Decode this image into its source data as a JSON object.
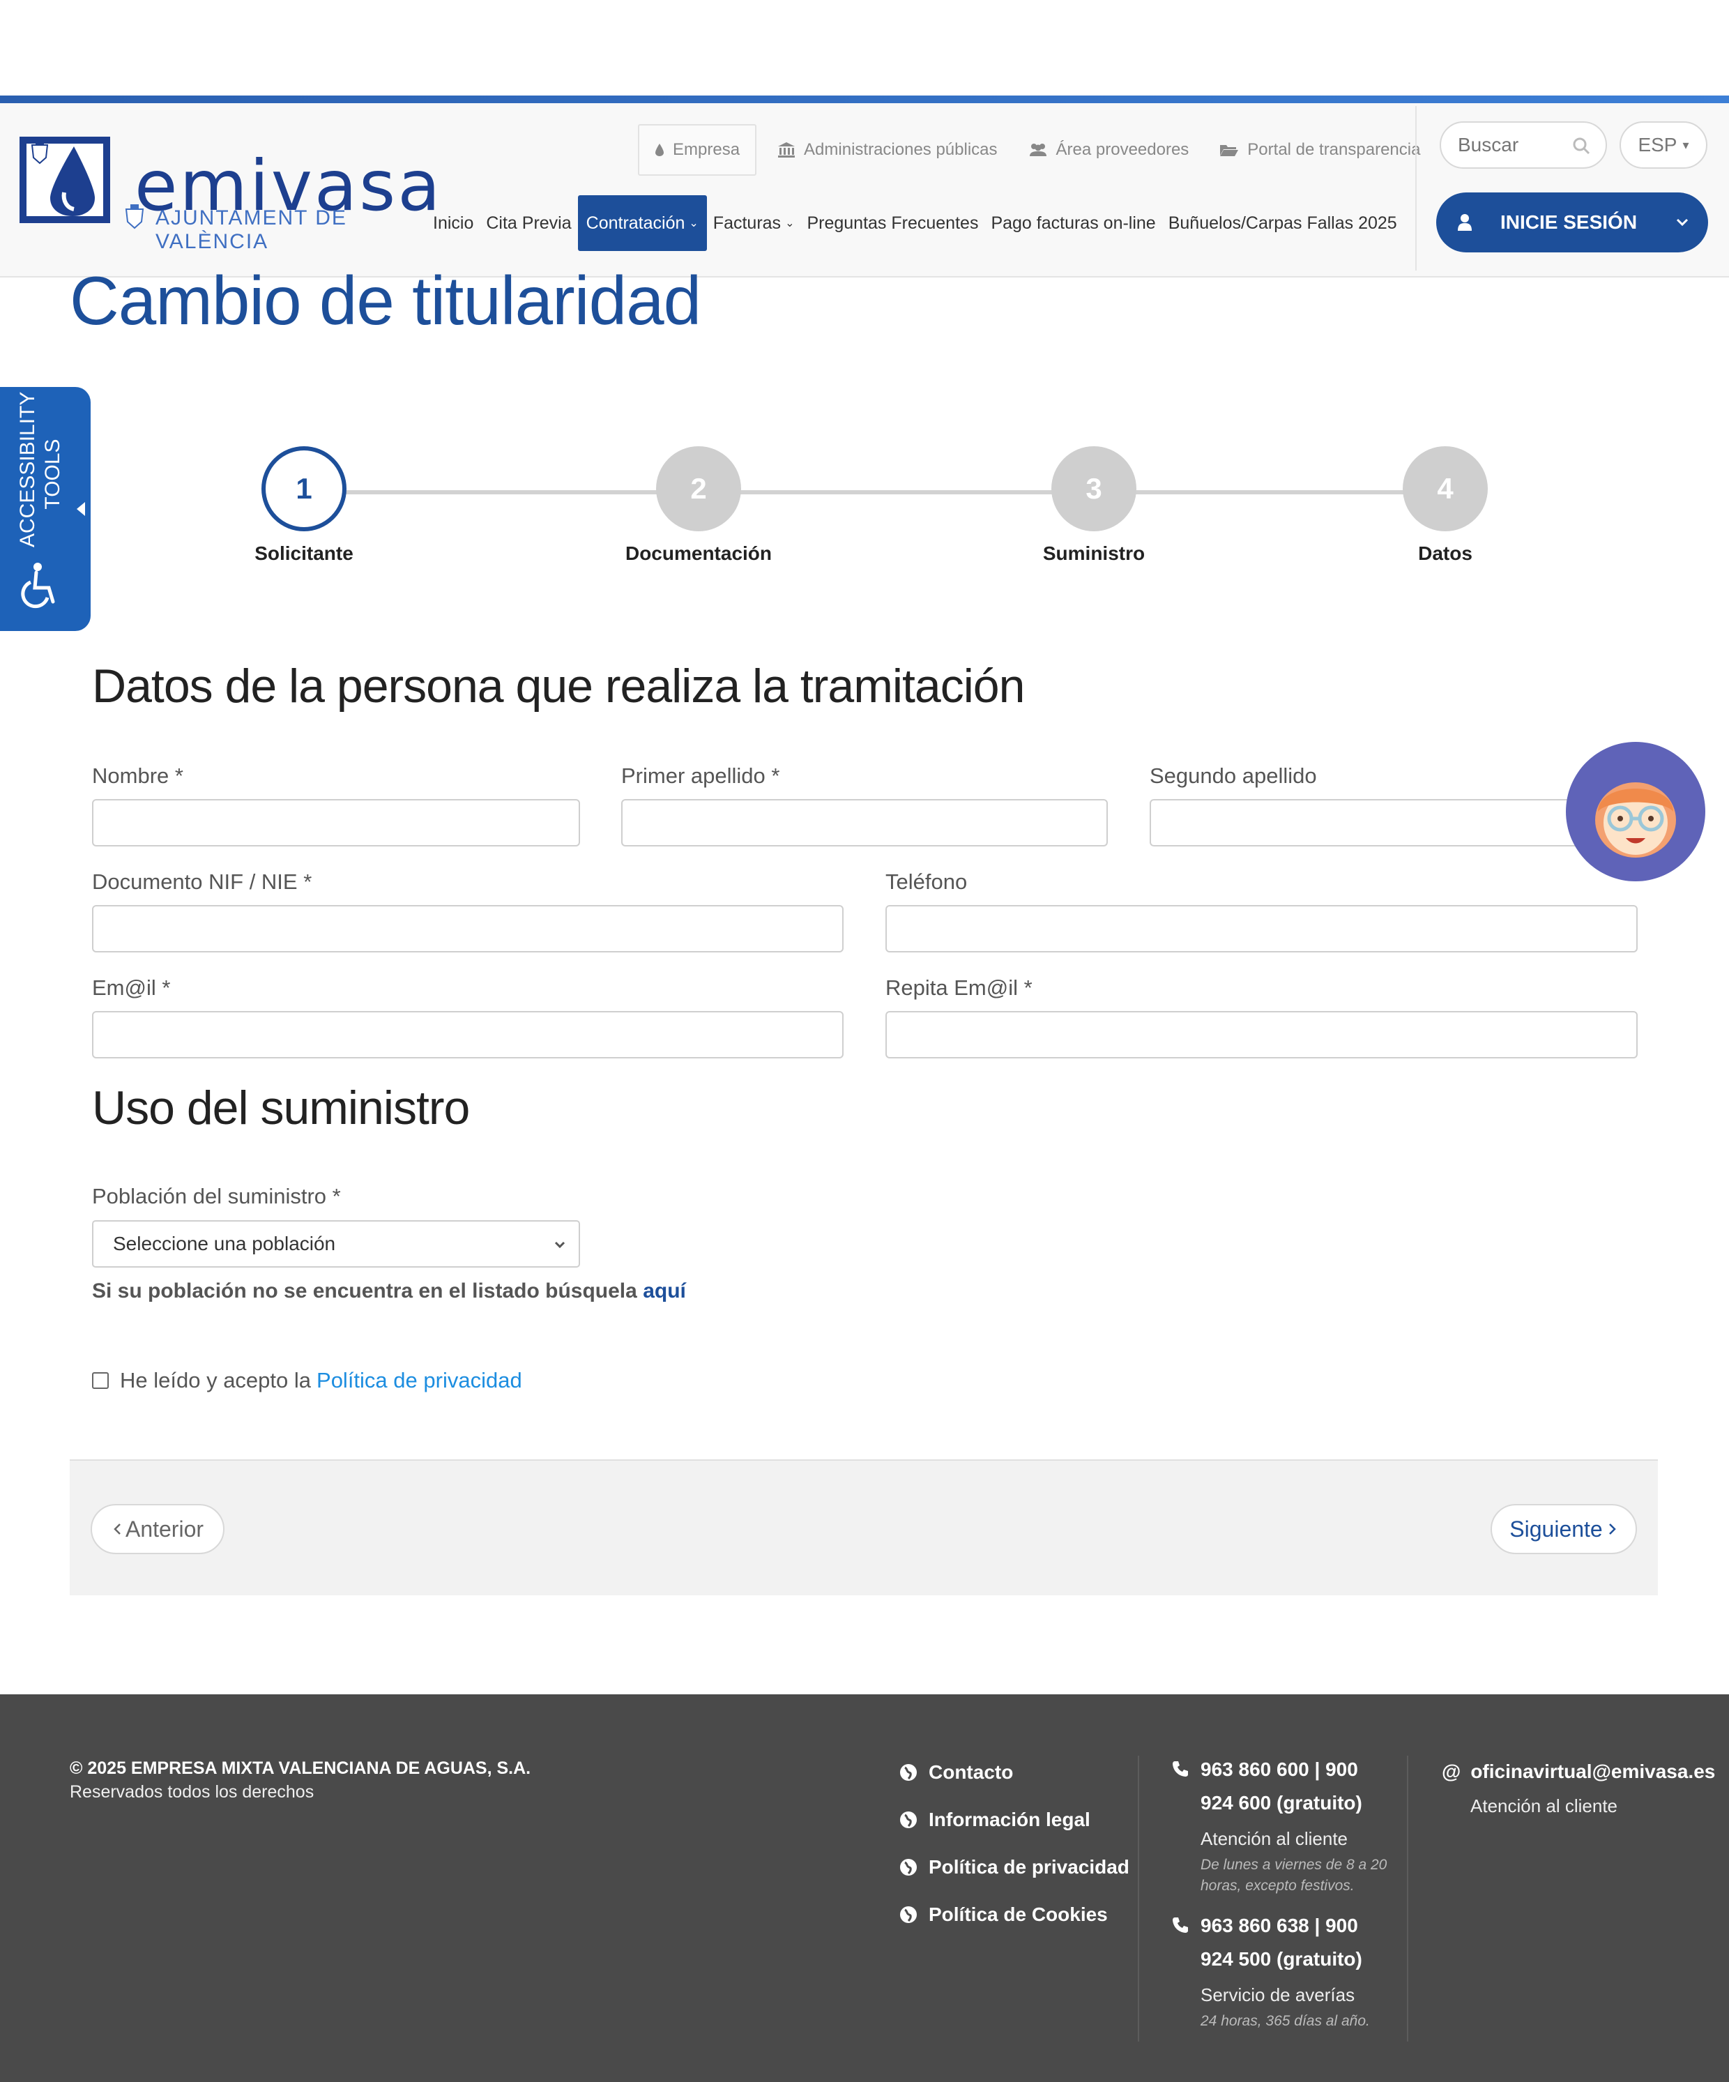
{
  "header": {
    "logo": {
      "word": "emivasa",
      "subtitle": "AJUNTAMENT DE VALÈNCIA"
    },
    "top_nav": [
      {
        "label": "Empresa",
        "icon": "drop-icon"
      },
      {
        "label": "Administraciones públicas",
        "icon": "institution-icon"
      },
      {
        "label": "Área proveedores",
        "icon": "users-icon"
      },
      {
        "label": "Portal de transparencia",
        "icon": "folder-open-icon"
      }
    ],
    "main_nav": [
      {
        "label": "Inicio"
      },
      {
        "label": "Cita Previa"
      },
      {
        "label": "Contratación",
        "active": true,
        "dropdown": true
      },
      {
        "label": "Facturas",
        "dropdown": true
      },
      {
        "label": "Preguntas Frecuentes"
      },
      {
        "label": "Pago facturas on-line"
      },
      {
        "label": "Buñuelos/Carpas Fallas 2025"
      }
    ],
    "search": {
      "placeholder": "Buscar"
    },
    "language": "ESP",
    "login_label": "INICIE SESIÓN"
  },
  "page": {
    "title": "Cambio de titularidad"
  },
  "accessibility": {
    "line1": "ACCESSIBILITY",
    "line2": "TOOLS"
  },
  "steps": [
    {
      "number": "1",
      "label": "Solicitante",
      "active": true
    },
    {
      "number": "2",
      "label": "Documentación",
      "active": false
    },
    {
      "number": "3",
      "label": "Suministro",
      "active": false
    },
    {
      "number": "4",
      "label": "Datos",
      "active": false
    }
  ],
  "form": {
    "section1_title": "Datos de la persona que realiza la tramitación",
    "fields": {
      "nombre": {
        "label": "Nombre *",
        "value": ""
      },
      "primer_apellido": {
        "label": "Primer apellido *",
        "value": ""
      },
      "segundo_apellido": {
        "label": "Segundo apellido",
        "value": ""
      },
      "documento": {
        "label": "Documento NIF / NIE *",
        "value": ""
      },
      "telefono": {
        "label": "Teléfono",
        "value": ""
      },
      "email": {
        "label": "Em@il *",
        "value": ""
      },
      "repita_email": {
        "label": "Repita Em@il *",
        "value": ""
      }
    },
    "section2_title": "Uso del suministro",
    "poblacion": {
      "label": "Población del suministro *",
      "selected": "Seleccione una población"
    },
    "hint_text": "Si su población no se encuentra en el listado búsquela",
    "hint_link": "aquí",
    "privacy_text": "He leído y acepto la",
    "privacy_link": "Política de privacidad",
    "checked": false
  },
  "navigation": {
    "prev": "Anterior",
    "next": "Siguiente"
  },
  "footer": {
    "copyright": "© 2025 EMPRESA MIXTA VALENCIANA DE AGUAS, S.A.",
    "rights": "Reservados todos los derechos",
    "links": [
      "Contacto",
      "Información legal",
      "Política de privacidad",
      "Política de Cookies"
    ],
    "phone1": {
      "line1": "963 860 600 | 900",
      "line2": "924 600 (gratuito)",
      "desc": "Atención al cliente",
      "note": "De lunes a viernes de 8 a 20 horas, excepto festivos."
    },
    "phone2": {
      "line1": "963 860 638 | 900",
      "line2": "924 500 (gratuito)",
      "desc": "Servicio de averías",
      "note": "24 horas, 365 días al año."
    },
    "email": "oficinavirtual@emivasa.es",
    "email_desc": "Atención al cliente"
  },
  "colors": {
    "primary": "#1d4f9a",
    "accessibility": "#1e62b8",
    "link": "#1c8de0",
    "footer": "#4a4a4a",
    "avatar": "#5f63b8"
  }
}
